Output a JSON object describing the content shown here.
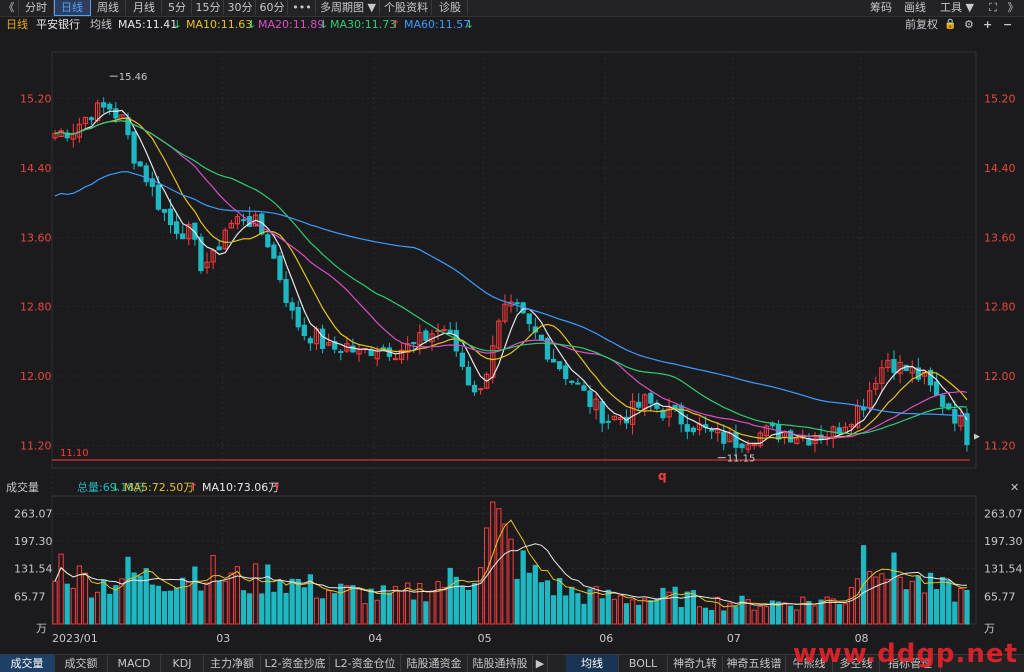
{
  "toolbar": {
    "back_glyph": "《",
    "tabs": [
      {
        "label": "分时",
        "active": false
      },
      {
        "label": "日线",
        "active": true
      },
      {
        "label": "周线",
        "active": false
      },
      {
        "label": "月线",
        "active": false
      },
      {
        "label": "5分",
        "active": false
      },
      {
        "label": "15分",
        "active": false
      },
      {
        "label": "30分",
        "active": false
      },
      {
        "label": "60分",
        "active": false
      },
      {
        "label": "•••",
        "active": false
      },
      {
        "label": "多周期图 ▼",
        "active": false
      },
      {
        "label": "个股资料",
        "active": false
      },
      {
        "label": "诊股",
        "active": false
      }
    ],
    "right": {
      "chips": "筹码",
      "draw": "画线",
      "tools": "工具 ▼",
      "expand": "⛶",
      "collapse": "》"
    }
  },
  "info": {
    "period": "日线",
    "stock_name": "平安银行",
    "ma_label": "均线",
    "ma": [
      {
        "text": "MA5:11.41",
        "arrow": "↓",
        "color": "#e8e8e8",
        "arrow_color": "#2ecc71"
      },
      {
        "text": "MA10:11.63",
        "arrow": "↓",
        "color": "#e6c31e",
        "arrow_color": "#2ecc71"
      },
      {
        "text": "MA20:11.89",
        "arrow": "↓",
        "color": "#d94fc4",
        "arrow_color": "#2ecc71"
      },
      {
        "text": "MA30:11.73",
        "arrow": "↑",
        "color": "#2ecc71",
        "arrow_color": "#ff4d4d"
      },
      {
        "text": "MA60:11.57",
        "arrow": "↓",
        "color": "#3d9bff",
        "arrow_color": "#2ecc71"
      }
    ],
    "right": {
      "adjust": "前复权",
      "lock": "🔒",
      "settings": "⚙",
      "zoom_in": "+",
      "zoom_out": "−"
    }
  },
  "annotations": {
    "high": "15.46",
    "low": "11.15",
    "support": "11.10",
    "marker": "q"
  },
  "volume": {
    "title": "成交量",
    "total": "总量:69.18万",
    "total_arrow": "↓",
    "ma5": "MA5:72.50万",
    "ma5_arrow": "↑",
    "ma10": "MA10:73.06万",
    "ma10_arrow": "↑",
    "unit": "万",
    "ticks": [
      "263.07",
      "197.30",
      "131.54",
      "65.77"
    ],
    "close_glyph": "✕"
  },
  "bottom_tabs": [
    {
      "label": "成交量",
      "active": true
    },
    {
      "label": "成交额",
      "active": false
    },
    {
      "label": "MACD",
      "active": false
    },
    {
      "label": "KDJ",
      "active": false
    },
    {
      "label": "主力净额",
      "active": false
    },
    {
      "label": "L2-资金抄底",
      "active": false
    },
    {
      "label": "L2-资金仓位",
      "active": false
    },
    {
      "label": "陆股通资金",
      "active": false
    },
    {
      "label": "陆股通持股",
      "active": false
    },
    {
      "label": "▶",
      "active": false
    },
    {
      "label": "均线",
      "active": false,
      "blue": true
    },
    {
      "label": "BOLL",
      "active": false
    },
    {
      "label": "神奇九转",
      "active": false
    },
    {
      "label": "神奇五线谱",
      "active": false
    },
    {
      "label": "牛熊线",
      "active": false
    },
    {
      "label": "多空线",
      "active": false
    },
    {
      "label": "指标管理",
      "active": false
    }
  ],
  "watermark": "www.ddgp.net",
  "chart_data": {
    "type": "candlestick",
    "price_ticks": [
      "15.20",
      "14.40",
      "13.60",
      "12.80",
      "12.00",
      "11.20"
    ],
    "ylim": [
      11.1,
      15.6
    ],
    "x_labels": [
      {
        "label": "2023/01",
        "index": 0
      },
      {
        "label": "03",
        "index": 28
      },
      {
        "label": "04",
        "index": 53
      },
      {
        "label": "05",
        "index": 71
      },
      {
        "label": "06",
        "index": 91
      },
      {
        "label": "07",
        "index": 112
      },
      {
        "label": "08",
        "index": 133
      }
    ],
    "candles_count": 151,
    "price_anchors": [
      [
        0,
        14.8
      ],
      [
        3,
        14.85
      ],
      [
        6,
        15.05
      ],
      [
        9,
        15.1
      ],
      [
        11,
        14.95
      ],
      [
        13,
        14.55
      ],
      [
        15,
        14.3
      ],
      [
        17,
        14.0
      ],
      [
        19,
        13.75
      ],
      [
        22,
        13.65
      ],
      [
        24,
        13.3
      ],
      [
        26,
        13.35
      ],
      [
        28,
        13.7
      ],
      [
        31,
        13.85
      ],
      [
        33,
        13.75
      ],
      [
        35,
        13.55
      ],
      [
        37,
        13.15
      ],
      [
        39,
        12.7
      ],
      [
        41,
        12.5
      ],
      [
        43,
        12.45
      ],
      [
        45,
        12.3
      ],
      [
        48,
        12.35
      ],
      [
        50,
        12.25
      ],
      [
        53,
        12.35
      ],
      [
        56,
        12.3
      ],
      [
        59,
        12.35
      ],
      [
        62,
        12.5
      ],
      [
        64,
        12.55
      ],
      [
        66,
        12.3
      ],
      [
        68,
        11.95
      ],
      [
        70,
        11.8
      ],
      [
        72,
        12.4
      ],
      [
        74,
        12.75
      ],
      [
        76,
        12.75
      ],
      [
        78,
        12.55
      ],
      [
        80,
        12.4
      ],
      [
        82,
        12.2
      ],
      [
        85,
        11.95
      ],
      [
        88,
        11.7
      ],
      [
        91,
        11.5
      ],
      [
        94,
        11.55
      ],
      [
        97,
        11.7
      ],
      [
        100,
        11.6
      ],
      [
        103,
        11.5
      ],
      [
        106,
        11.4
      ],
      [
        109,
        11.3
      ],
      [
        112,
        11.25
      ],
      [
        114,
        11.3
      ],
      [
        117,
        11.35
      ],
      [
        120,
        11.35
      ],
      [
        124,
        11.3
      ],
      [
        128,
        11.35
      ],
      [
        131,
        11.55
      ],
      [
        133,
        11.7
      ],
      [
        135,
        12.0
      ],
      [
        137,
        12.2
      ],
      [
        139,
        12.1
      ],
      [
        141,
        12.05
      ],
      [
        143,
        11.95
      ],
      [
        145,
        11.75
      ],
      [
        147,
        11.65
      ],
      [
        149,
        11.45
      ],
      [
        150,
        11.3
      ]
    ],
    "volume_ylim": [
      0,
      290
    ],
    "volume_anchors": [
      [
        0,
        150
      ],
      [
        4,
        110
      ],
      [
        8,
        95
      ],
      [
        12,
        120
      ],
      [
        16,
        105
      ],
      [
        20,
        115
      ],
      [
        24,
        130
      ],
      [
        28,
        110
      ],
      [
        32,
        100
      ],
      [
        36,
        115
      ],
      [
        40,
        95
      ],
      [
        44,
        80
      ],
      [
        48,
        75
      ],
      [
        52,
        70
      ],
      [
        56,
        65
      ],
      [
        60,
        80
      ],
      [
        64,
        100
      ],
      [
        68,
        110
      ],
      [
        70,
        160
      ],
      [
        72,
        250
      ],
      [
        74,
        200
      ],
      [
        76,
        150
      ],
      [
        78,
        120
      ],
      [
        82,
        90
      ],
      [
        86,
        70
      ],
      [
        90,
        65
      ],
      [
        94,
        60
      ],
      [
        98,
        60
      ],
      [
        102,
        65
      ],
      [
        106,
        55
      ],
      [
        110,
        50
      ],
      [
        114,
        48
      ],
      [
        118,
        50
      ],
      [
        122,
        52
      ],
      [
        126,
        55
      ],
      [
        130,
        60
      ],
      [
        133,
        170
      ],
      [
        135,
        180
      ],
      [
        137,
        130
      ],
      [
        140,
        110
      ],
      [
        143,
        90
      ],
      [
        146,
        80
      ],
      [
        150,
        70
      ]
    ],
    "ma_series": [
      {
        "name": "MA5",
        "color": "#e8e8e8"
      },
      {
        "name": "MA10",
        "color": "#e6c31e"
      },
      {
        "name": "MA20",
        "color": "#d94fc4"
      },
      {
        "name": "MA30",
        "color": "#2ecc71"
      },
      {
        "name": "MA60",
        "color": "#3d9bff"
      }
    ],
    "up_color": "#ff3b3b",
    "down_color": "#1fb8c2"
  }
}
